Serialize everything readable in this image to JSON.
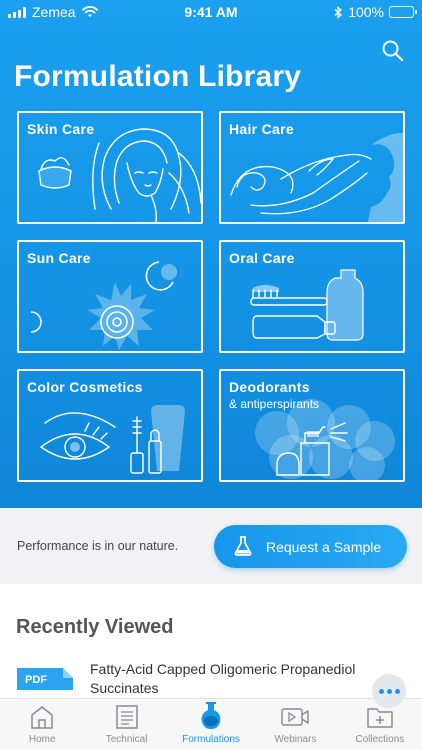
{
  "status_bar": {
    "carrier": "Zemea",
    "time": "9:41 AM",
    "battery": "100%",
    "battery_level": 1.0,
    "icons": [
      "signal-icon",
      "wifi-icon",
      "bluetooth-icon",
      "battery-icon"
    ]
  },
  "header": {
    "title": "Formulation Library",
    "search_icon": "search-icon"
  },
  "categories": [
    {
      "label": "Skin Care",
      "sublabel": "",
      "icon": "skin-care-illustration"
    },
    {
      "label": "Hair Care",
      "sublabel": "",
      "icon": "hair-care-illustration"
    },
    {
      "label": "Sun Care",
      "sublabel": "",
      "icon": "sun-care-illustration"
    },
    {
      "label": "Oral Care",
      "sublabel": "",
      "icon": "oral-care-illustration"
    },
    {
      "label": "Color Cosmetics",
      "sublabel": "",
      "icon": "color-cosmetics-illustration"
    },
    {
      "label": "Deodorants",
      "sublabel": "& antiperspirants",
      "icon": "deodorant-illustration"
    }
  ],
  "promo": {
    "text": "Performance is in our nature.",
    "button_label": "Request a Sample",
    "button_icon": "flask-icon"
  },
  "recently_viewed": {
    "title": "Recently Viewed",
    "items": [
      {
        "badge": "PDF",
        "title": "Fatty-Acid Capped Oligomeric Propanediol Succinates"
      }
    ],
    "more_icon": "more-dots-icon"
  },
  "tabbar": {
    "tabs": [
      {
        "label": "Home",
        "icon": "home-icon",
        "active": false
      },
      {
        "label": "Technical",
        "icon": "document-icon",
        "active": false
      },
      {
        "label": "Formulations",
        "icon": "flask-icon",
        "active": true
      },
      {
        "label": "Webinars",
        "icon": "video-icon",
        "active": false
      },
      {
        "label": "Collections",
        "icon": "folder-add-icon",
        "active": false
      }
    ]
  },
  "colors": {
    "hero_blue": "#1594e6",
    "accent": "#1a96e8",
    "promo_bg": "#f2f2f4"
  }
}
